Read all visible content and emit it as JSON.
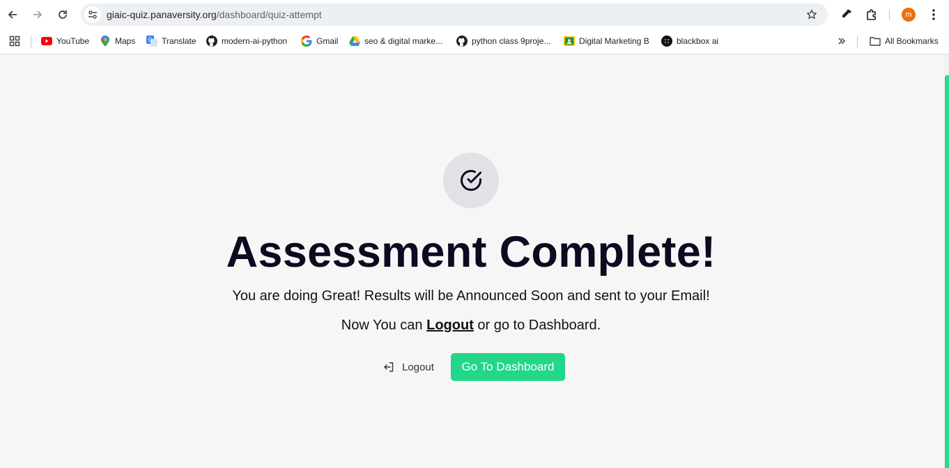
{
  "browser": {
    "url_host": "giaic-quiz.panaversity.org",
    "url_path": "/dashboard/quiz-attempt",
    "profile_initial": "m",
    "profile_color": "#e8710a"
  },
  "bookmarks": [
    {
      "label": "YouTube",
      "icon": "youtube-icon"
    },
    {
      "label": "Maps",
      "icon": "maps-icon"
    },
    {
      "label": "Translate",
      "icon": "translate-icon"
    },
    {
      "label": "modern-ai-python",
      "icon": "github-icon"
    },
    {
      "label": "Gmail",
      "icon": "google-icon"
    },
    {
      "label": "seo & digital marke...",
      "icon": "drive-icon"
    },
    {
      "label": "python class 9proje...",
      "icon": "github-icon"
    },
    {
      "label": "Digital Marketing B",
      "icon": "classroom-icon"
    },
    {
      "label": "blackbox ai",
      "icon": "blackbox-icon"
    }
  ],
  "all_bookmarks_label": "All Bookmarks",
  "main": {
    "title": "Assessment Complete!",
    "message": "You are doing Great! Results will be Announced Soon and sent to your Email!",
    "prompt_before": "Now You can ",
    "prompt_link": "Logout",
    "prompt_after": " or go to Dashboard.",
    "logout_button": "Logout",
    "dashboard_button": "Go To Dashboard",
    "accent_color": "#22d68a"
  }
}
